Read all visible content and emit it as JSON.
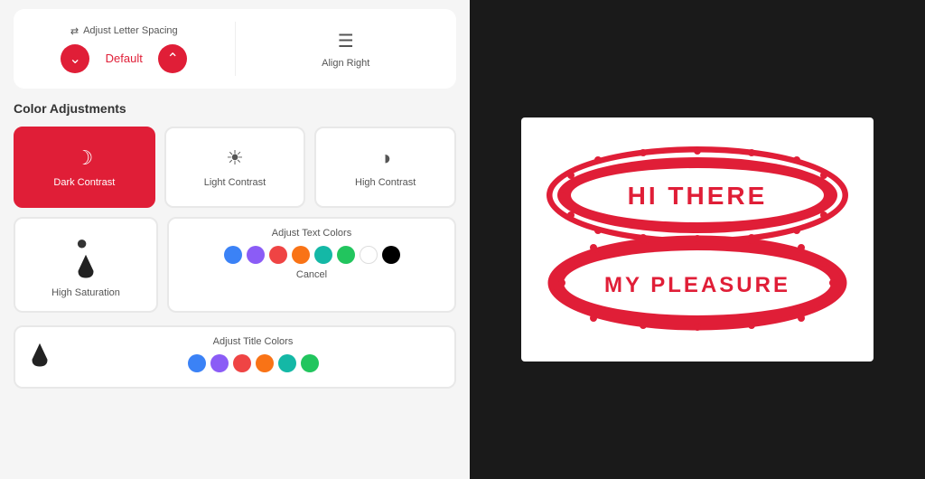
{
  "left_panel": {
    "letter_spacing": {
      "label": "Adjust Letter Spacing",
      "value": "Default",
      "decrement_label": "▾",
      "increment_label": "▴"
    },
    "align_right": {
      "label": "Align Right"
    },
    "color_adjustments": {
      "title": "Color Adjustments",
      "items": [
        {
          "id": "dark-contrast",
          "label": "Dark Contrast",
          "icon": "moon",
          "active": true
        },
        {
          "id": "light-contrast",
          "label": "Light Contrast",
          "icon": "sun",
          "active": false
        },
        {
          "id": "high-contrast",
          "label": "High Contrast",
          "icon": "contrast",
          "active": false
        }
      ]
    },
    "high_saturation": {
      "label": "High Saturation",
      "icon": "droplet"
    },
    "adjust_text_colors": {
      "title": "Adjust Text Colors",
      "colors": [
        "#3b82f6",
        "#8b5cf6",
        "#ef4444",
        "#f97316",
        "#14b8a6",
        "#22c55e",
        "#ffffff",
        "#000000"
      ],
      "cancel": "Cancel"
    },
    "adjust_title_colors": {
      "title": "Adjust Title Colors",
      "colors": [
        "#3b82f6",
        "#8b5cf6",
        "#ef4444",
        "#f97316",
        "#14b8a6",
        "#22c55e"
      ]
    }
  },
  "right_panel": {
    "stamp1_text": "HI THERE",
    "stamp2_text": "MY PLEASURE"
  },
  "accent_color": "#e01e37"
}
